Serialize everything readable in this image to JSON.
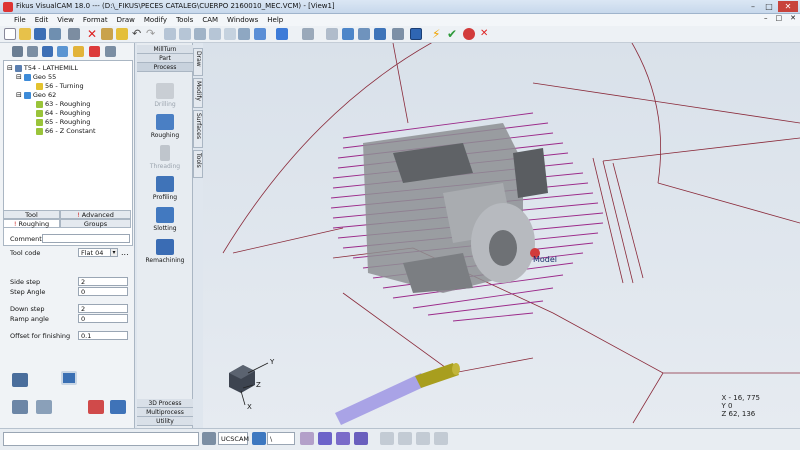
{
  "window": {
    "title": "Fikus VisualCAM 18.0 --- (D:\\_FIKUS\\PECES CATALEG\\CUERPO 2160010_MEC.VCM) - [View1]"
  },
  "menu": [
    "File",
    "Edit",
    "View",
    "Format",
    "Draw",
    "Modify",
    "Tools",
    "CAM",
    "Windows",
    "Help"
  ],
  "tree": {
    "items": [
      "T54 - LATHEMILL",
      "Geo 55",
      "56 - Turning",
      "Geo 62",
      "63 - Roughing",
      "64 - Roughing",
      "65 - Roughing",
      "66 - Z Constant"
    ]
  },
  "tabs": {
    "tool": "Tool",
    "advanced": "Advanced",
    "roughing": "Roughing",
    "groups": "Groups"
  },
  "form": {
    "comment_label": "Comment",
    "tool_code_label": "Tool code",
    "tool_code_value": "Flat 04",
    "side_step_label": "Side step",
    "side_step_value": "2",
    "step_angle_label": "Step Angle",
    "step_angle_value": "0",
    "down_step_label": "Down step",
    "down_step_value": "2",
    "ramp_angle_label": "Ramp angle",
    "ramp_angle_value": "0",
    "offset_label": "Offset for finishing",
    "offset_value": "0.1"
  },
  "process_panel": {
    "top": [
      "MillTurn",
      "Part",
      "Process"
    ],
    "items": [
      {
        "label": "Drilling",
        "enabled": false
      },
      {
        "label": "Roughing",
        "enabled": true
      },
      {
        "label": "Threading",
        "enabled": false
      },
      {
        "label": "Profiling",
        "enabled": true
      },
      {
        "label": "Slotting",
        "enabled": true
      },
      {
        "label": "Remachining",
        "enabled": true
      }
    ],
    "bottom": [
      "3D Process",
      "Multiprocess",
      "Utility"
    ]
  },
  "vertical_tabs": [
    "Draw",
    "Modify",
    "Surfaces",
    "Tools"
  ],
  "viewport": {
    "model_label": "Model",
    "axis_y": "Y",
    "axis_z": "Z",
    "axis_x": "X",
    "coord_x": "X - 16, 775",
    "coord_y": "Y  0",
    "coord_z": "Z  62, 136"
  },
  "statusbar": {
    "ucs": "UCSCAM",
    "layer": "\\"
  },
  "colors": {
    "toolpath": "#9b2a8a",
    "wire": "#8a2a3a",
    "accent": "#2b6cc4"
  }
}
